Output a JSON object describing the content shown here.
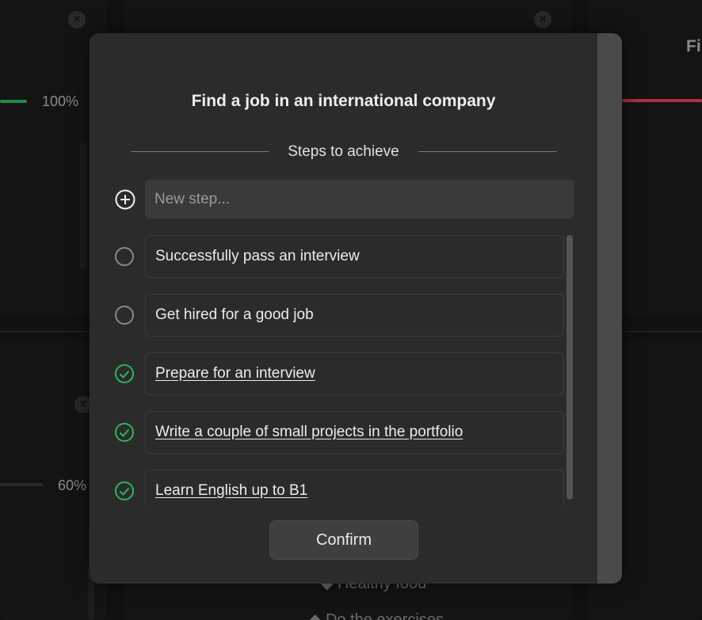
{
  "background": {
    "percent_top": "100%",
    "percent_bottom": "60%",
    "right_title_fragment": "Fi",
    "items": [
      "Healthy food",
      "Do the exercises"
    ],
    "colors": {
      "green_bar": "#1f8a4c",
      "red_bar": "#b03040"
    }
  },
  "modal": {
    "title": "Find a job in an international company",
    "section_label": "Steps to achieve",
    "new_step_placeholder": "New step...",
    "add_icon": "plus-circle-icon",
    "confirm_label": "Confirm",
    "steps": [
      {
        "label": "Successfully pass an interview",
        "done": false
      },
      {
        "label": "Get hired for a good job",
        "done": false
      },
      {
        "label": "Prepare for an interview",
        "done": true
      },
      {
        "label": "Write a couple of small projects in the portfolio",
        "done": true
      },
      {
        "label": "Learn English up to B1",
        "done": true
      }
    ],
    "colors": {
      "done": "#2fb360",
      "pending": "#8a8a8a"
    }
  }
}
